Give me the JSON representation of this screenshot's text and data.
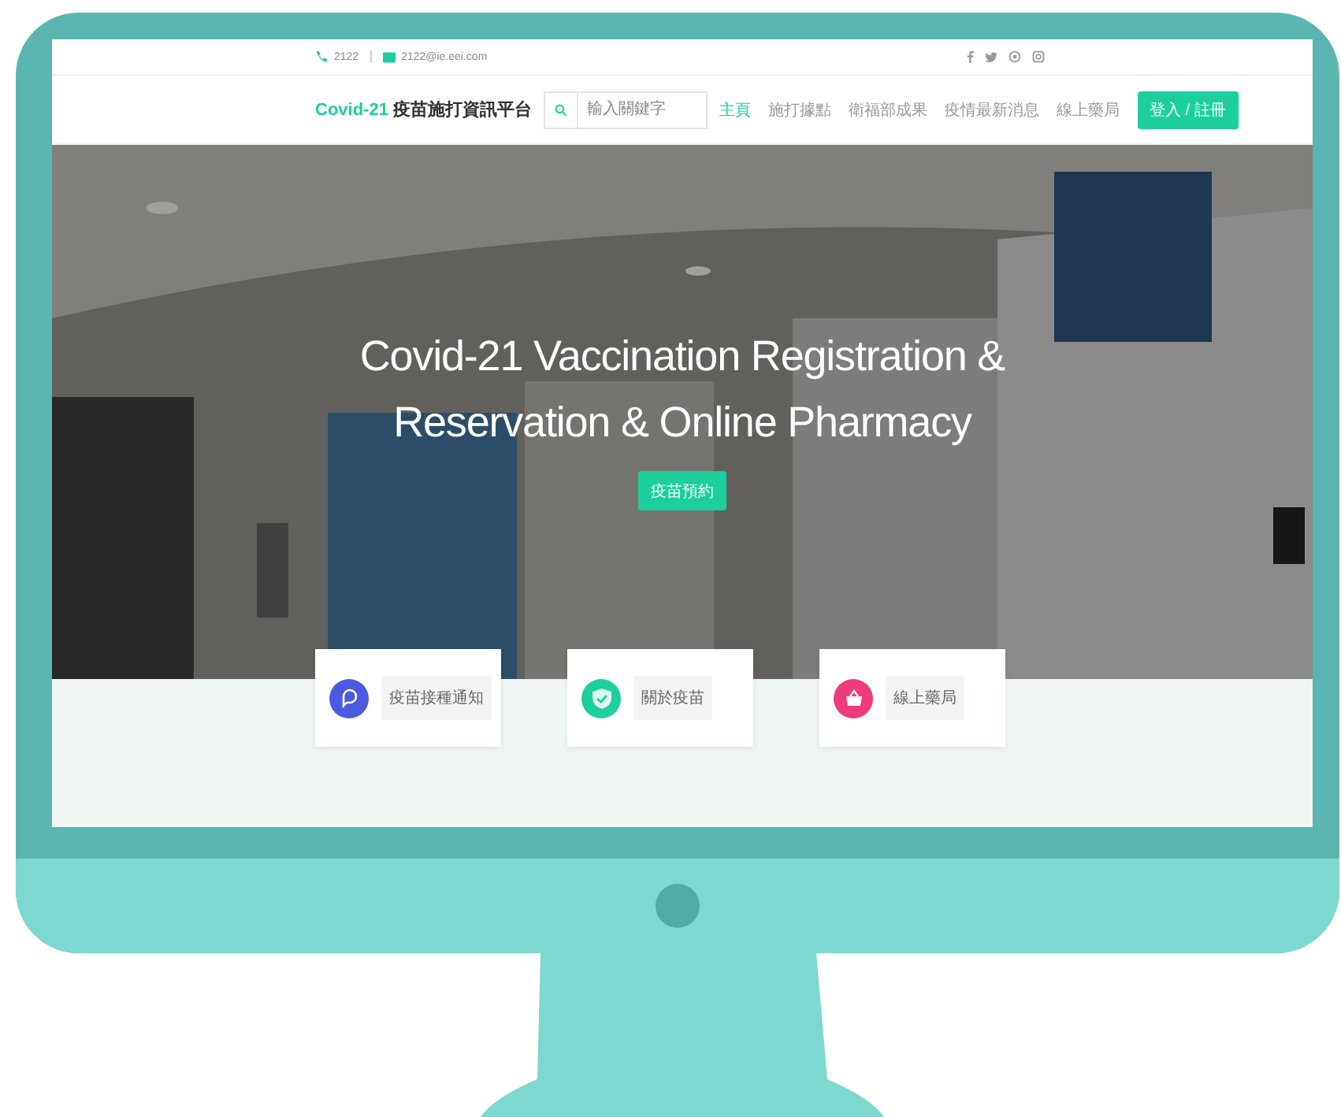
{
  "top_bar": {
    "phone": "2122",
    "email": "2122@ie.eei.com"
  },
  "nav": {
    "brand": "Covid-21",
    "title": "疫苗施打資訊平台",
    "search": {
      "placeholder": "輸入關鍵字"
    },
    "links": [
      {
        "label": "主頁",
        "selected": true
      },
      {
        "label": "施打據點",
        "selected": false
      },
      {
        "label": "衛福部成果",
        "selected": false
      },
      {
        "label": "疫情最新消息",
        "selected": false
      },
      {
        "label": "線上藥局",
        "selected": false
      }
    ],
    "login": "登入 / 註冊"
  },
  "hero": {
    "title": "Covid-21 Vaccination Registration & Reservation & Online Pharmacy",
    "button": "疫苗預約"
  },
  "cards": [
    {
      "kind": "chat",
      "label": "疫苗接種通知",
      "color": "#4b5be0"
    },
    {
      "kind": "shield",
      "label": "關於疫苗",
      "color": "#1ccf9c"
    },
    {
      "kind": "basket",
      "label": "線上藥局",
      "color": "#f03a7a"
    }
  ]
}
